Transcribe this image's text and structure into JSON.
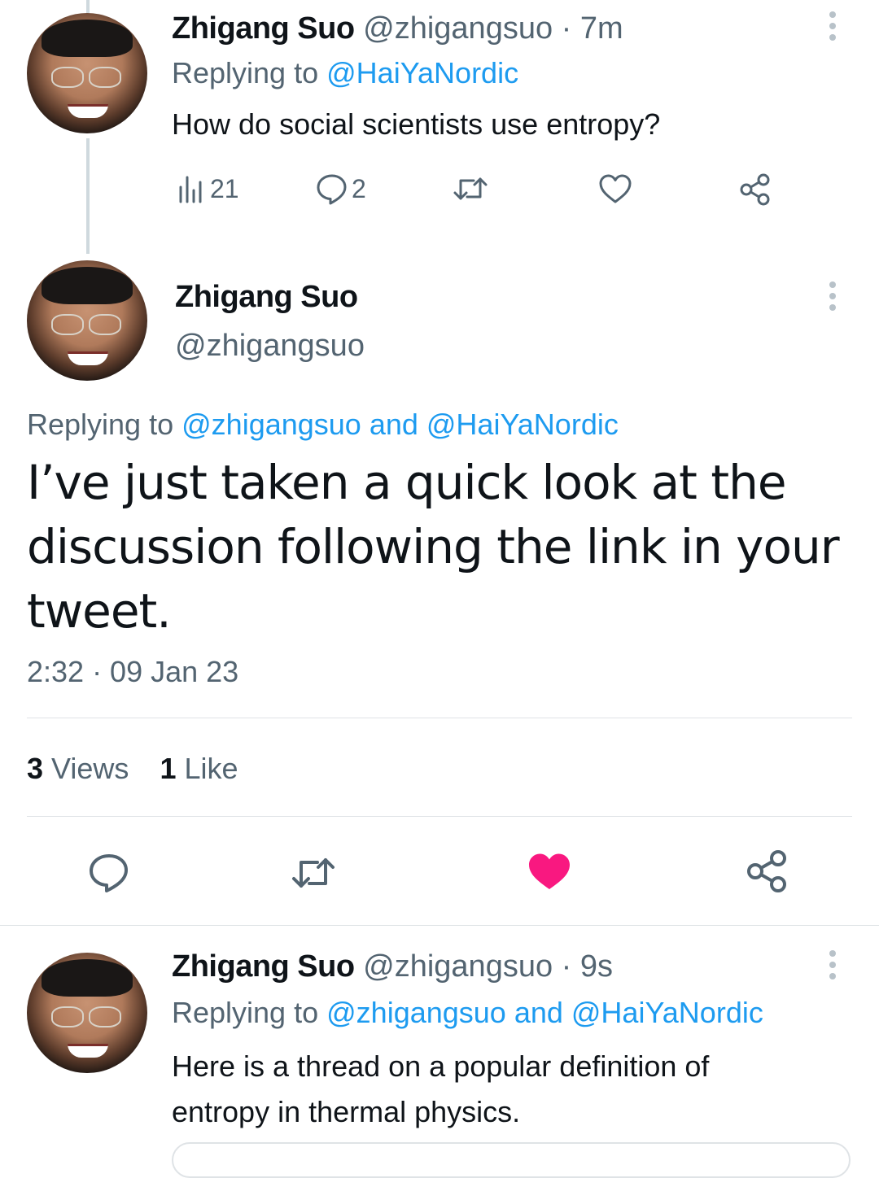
{
  "tweet1": {
    "display_name": "Zhigang Suo",
    "handle": "@zhigangsuo",
    "time": "· 7m",
    "replying_prefix": "Replying to",
    "replying_to": "@HaiYaNordic",
    "text": "How do social scientists use entropy?",
    "views_count": "21",
    "replies_count": "2"
  },
  "tweet2": {
    "display_name": "Zhigang Suo",
    "handle": "@zhigangsuo",
    "replying_prefix": "Replying to",
    "replying_to": "@zhigangsuo and @HaiYaNordic",
    "text_lines": [
      "I’ve just taken a quick look at the",
      "discussion following the link in your",
      "tweet."
    ],
    "timestamp": "2:32 · 09 Jan 23",
    "views_count": "3",
    "views_label": "Views",
    "likes_count": "1",
    "likes_label": "Like",
    "liked": true
  },
  "tweet3": {
    "display_name": "Zhigang Suo",
    "handle": "@zhigangsuo",
    "time": "· 9s",
    "replying_prefix": "Replying to",
    "replying_to": "@zhigangsuo and @HaiYaNordic",
    "text_lines": [
      "Here is a thread on a popular definition of",
      "entropy in thermal physics."
    ]
  },
  "icons": {
    "views": "bar-chart-icon",
    "reply": "speech-bubble-icon",
    "retweet": "retweet-icon",
    "like": "heart-icon",
    "share": "share-nodes-icon",
    "more": "vertical-ellipsis-icon"
  },
  "colors": {
    "link": "#1d9bf0",
    "muted": "#536471",
    "liked_heart": "#f91880"
  }
}
